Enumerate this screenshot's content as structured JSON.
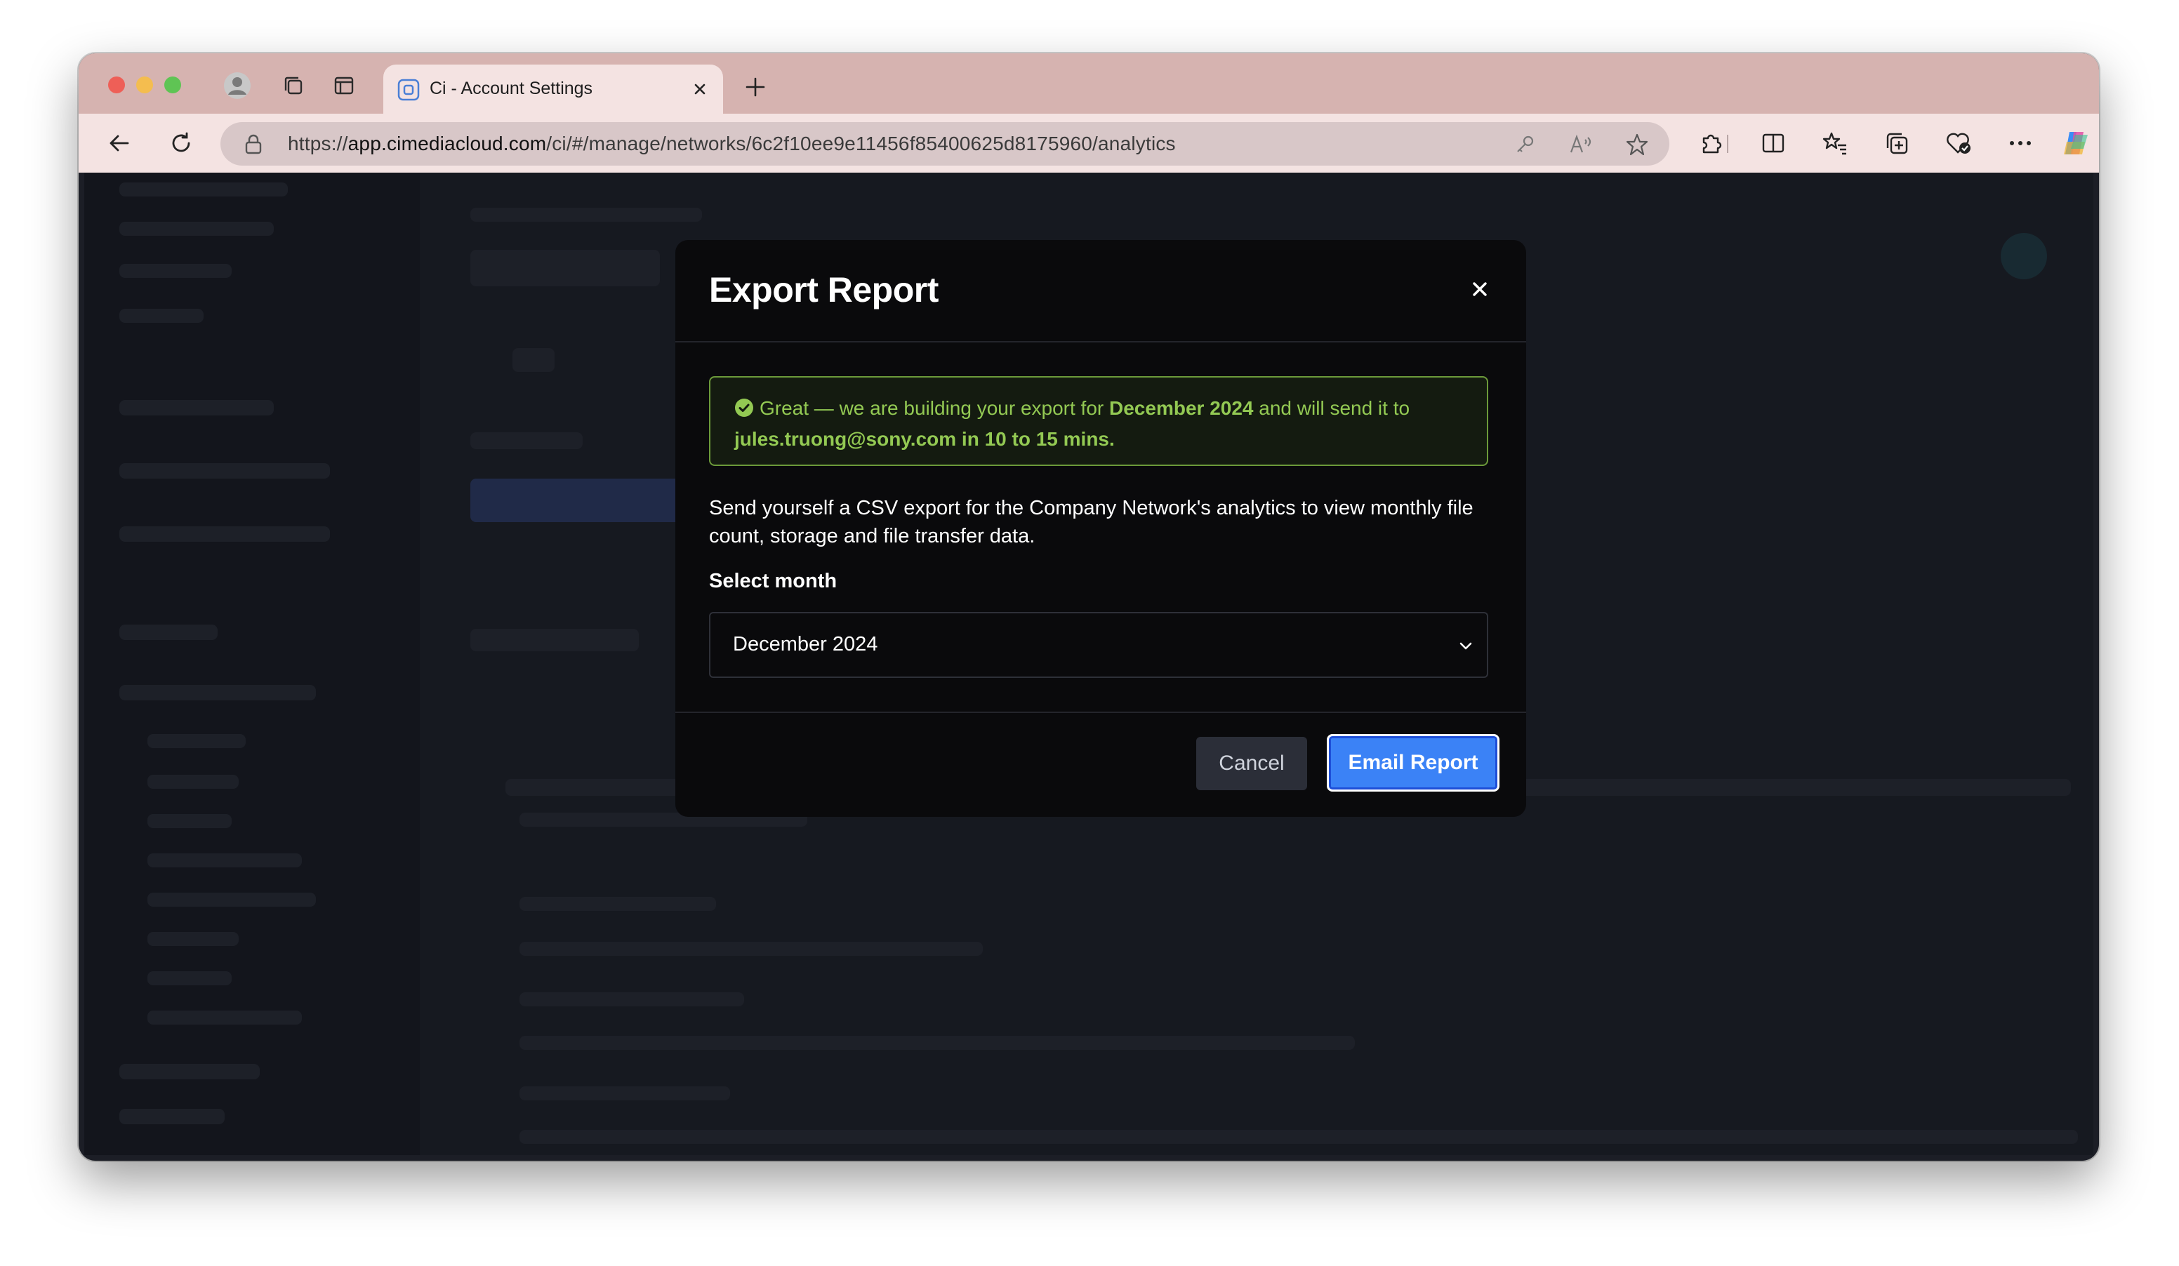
{
  "browser": {
    "tab": {
      "title": "Ci - Account Settings"
    },
    "url": {
      "scheme": "https://",
      "host": "app.cimediacloud.com",
      "path": "/ci/#/manage/networks/6c2f10ee9e11456f85400625d8175960/analytics"
    },
    "icons": {
      "profile": "profile-icon",
      "workspaces": "workspaces-icon",
      "tab_actions": "vertical-tabs-icon",
      "new_tab": "plus-icon",
      "back": "back-arrow-icon",
      "refresh": "refresh-icon",
      "lock": "lock-icon",
      "key": "key-icon",
      "read_aloud": "read-aloud-icon",
      "favorite": "star-icon",
      "extensions": "puzzle-icon",
      "split": "split-screen-icon",
      "favorites": "favorites-icon",
      "collections": "collections-icon",
      "health": "browser-essentials-icon",
      "more": "more-icon",
      "copilot": "copilot-icon"
    }
  },
  "modal": {
    "title": "Export Report",
    "alert": {
      "prefix": "Great — we are building your export for ",
      "month": "December 2024",
      "middle": " and will send it to ",
      "email_and_time": "jules.truong@sony.com in 10 to 15 mins."
    },
    "description": "Send yourself a CSV export for the Company Network's analytics to view monthly file count, storage and file transfer data.",
    "select_label": "Select month",
    "selected_month": "December 2024",
    "cancel_label": "Cancel",
    "submit_label": "Email Report"
  },
  "colors": {
    "accent": "#3b82f6",
    "success": "#93c953",
    "modal_bg": "#0a0a0c",
    "titlebar": "#d6b3b0"
  }
}
